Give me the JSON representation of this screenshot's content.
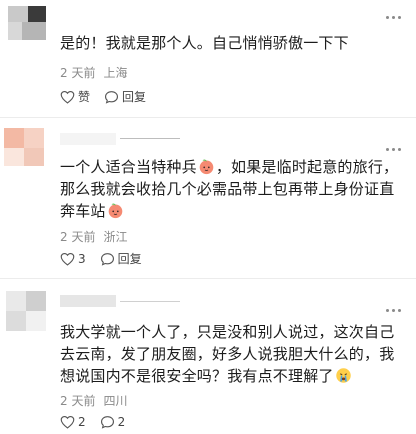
{
  "comments": [
    {
      "text": "是的！我就是那个人。自己悄悄骄傲一下下",
      "time": "2 天前",
      "location": "上海",
      "like_label": "赞",
      "reply_label": "回复"
    },
    {
      "text_a": "一个人适合当特种兵",
      "text_b": "，如果是临时起意的旅行，那么我就会收拾几个必需品带上包再带上身份证直奔车站",
      "emoji_icon": "peach-face-emoji",
      "time": "2 天前",
      "location": "浙江",
      "like_count": "3",
      "reply_label": "回复"
    },
    {
      "text": "我大学就一个人了，只是没和别人说过，这次自己去云南，发了朋友圈，好多人说我胆大什么的，我想说国内不是很安全吗？我有点不理解了",
      "emoji_icon": "crying-face-emoji",
      "time": "2 天前",
      "location": "四川",
      "like_count": "2",
      "reply_count": "2"
    }
  ],
  "icons": {
    "more": "more-options-icon",
    "like": "heart-icon",
    "reply": "comment-bubble-icon"
  }
}
